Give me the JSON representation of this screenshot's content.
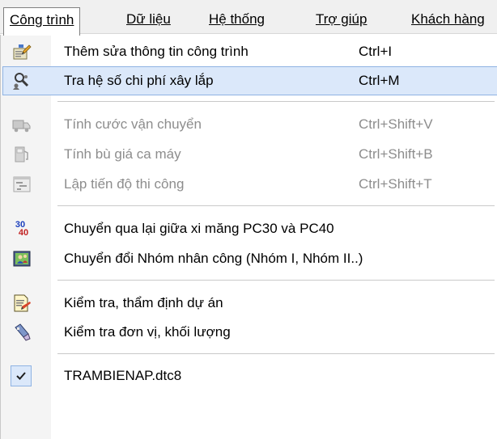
{
  "menubar": {
    "items": [
      {
        "label": "Công trình",
        "active": true
      },
      {
        "label": "Dữ liệu"
      },
      {
        "label": "Hệ thống"
      },
      {
        "label": "Trợ giúp"
      },
      {
        "label": "Khách hàng"
      }
    ]
  },
  "menu": {
    "items": [
      {
        "label": "Thêm sửa thông tin công trình",
        "shortcut": "Ctrl+I",
        "icon": "edit-document-icon",
        "enabled": true
      },
      {
        "label": "Tra hệ số chi phí xây lắp",
        "shortcut": "Ctrl+M",
        "icon": "search-people-icon",
        "enabled": true,
        "highlighted": true
      },
      {
        "label": "Tính cước vận chuyển",
        "shortcut": "Ctrl+Shift+V",
        "icon": "truck-icon",
        "enabled": false
      },
      {
        "label": "Tính bù giá ca máy",
        "shortcut": "Ctrl+Shift+B",
        "icon": "fuel-pump-icon",
        "enabled": false
      },
      {
        "label": "Lập tiến độ thi công",
        "shortcut": "Ctrl+Shift+T",
        "icon": "gantt-chart-icon",
        "enabled": false
      },
      {
        "label": "Chuyển qua lại giữa xi măng PC30 và PC40",
        "shortcut": "",
        "icon": "swap-30-40-icon",
        "icon_text_top": "30",
        "icon_text_bottom": "40",
        "enabled": true
      },
      {
        "label": "Chuyển đổi Nhóm nhân công (Nhóm I, Nhóm II..)",
        "shortcut": "",
        "icon": "labor-group-icon",
        "enabled": true
      },
      {
        "label": "Kiểm tra, thẩm định dự án",
        "shortcut": "",
        "icon": "document-check-icon",
        "enabled": true
      },
      {
        "label": "Kiểm tra đơn vị, khối lượng",
        "shortcut": "",
        "icon": "inspect-brush-icon",
        "enabled": true
      },
      {
        "label": "TRAMBIENAP.dtc8",
        "shortcut": "",
        "icon": "checkmark-icon",
        "enabled": true,
        "checked": true
      }
    ]
  },
  "colors": {
    "highlight_bg": "#dbe8fa",
    "highlight_border": "#8fb3e3",
    "disabled_text": "#8d8d8d",
    "menubar_bg": "#f0f0f0"
  }
}
